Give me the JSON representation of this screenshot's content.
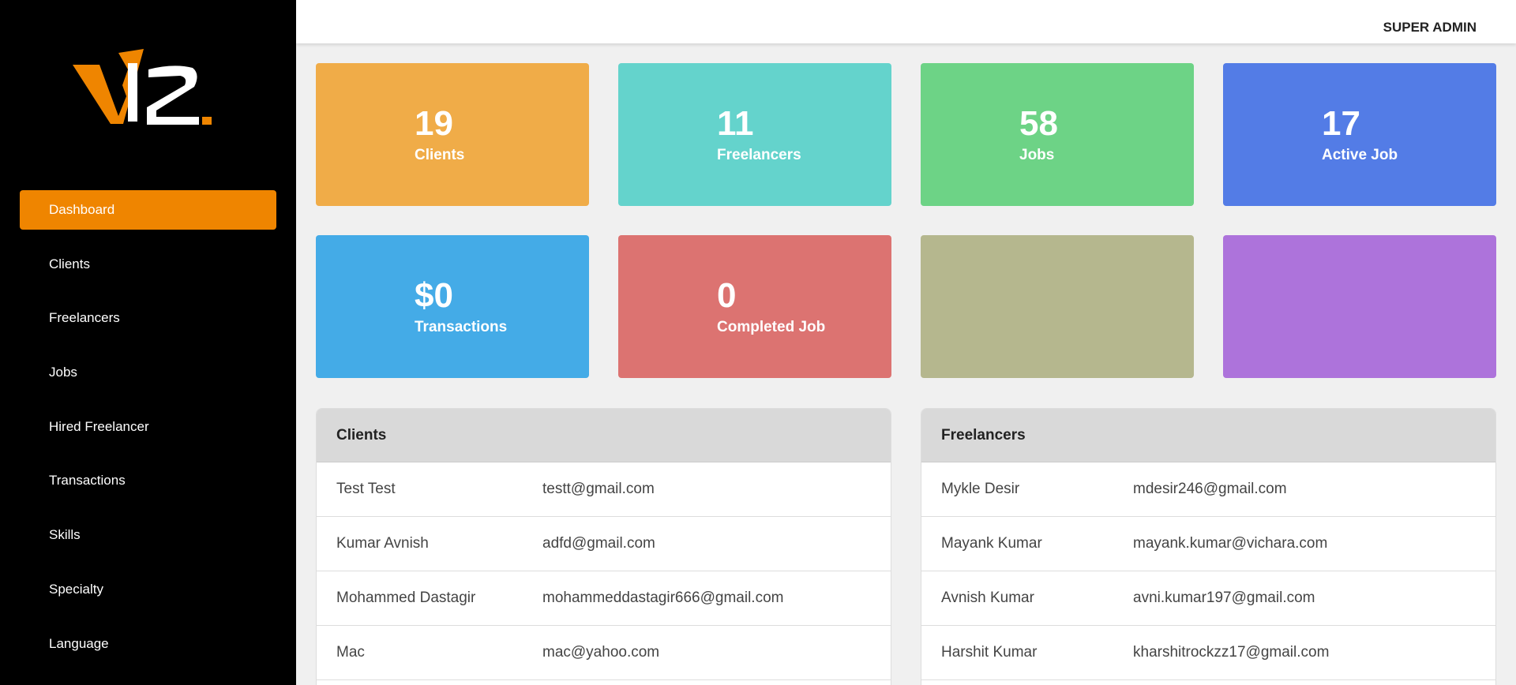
{
  "header": {
    "role": "SUPER ADMIN"
  },
  "logo": {
    "text": "V12"
  },
  "sidebar": {
    "items": [
      {
        "label": "Dashboard",
        "active": true
      },
      {
        "label": "Clients"
      },
      {
        "label": "Freelancers"
      },
      {
        "label": "Jobs"
      },
      {
        "label": "Hired Freelancer"
      },
      {
        "label": "Transactions"
      },
      {
        "label": "Skills"
      },
      {
        "label": "Specialty"
      },
      {
        "label": "Language"
      }
    ]
  },
  "cards": [
    {
      "value": "19",
      "label": "Clients",
      "color": "#f0ac48"
    },
    {
      "value": "11",
      "label": "Freelancers",
      "color": "#64d3cc"
    },
    {
      "value": "58",
      "label": "Jobs",
      "color": "#6dd386"
    },
    {
      "value": "17",
      "label": "Active Job",
      "color": "#537ce6"
    },
    {
      "value": "$0",
      "label": "Transactions",
      "color": "#44abe7"
    },
    {
      "value": "0",
      "label": "Completed Job",
      "color": "#dc7371"
    },
    {
      "value": "",
      "label": "",
      "color": "#b5b78e"
    },
    {
      "value": "",
      "label": "",
      "color": "#ad73db"
    }
  ],
  "clients": {
    "title": "Clients",
    "rows": [
      {
        "name": "Test Test",
        "email": "testt@gmail.com"
      },
      {
        "name": "Kumar Avnish",
        "email": "adfd@gmail.com"
      },
      {
        "name": "Mohammed Dastagir",
        "email": "mohammeddastagir666@gmail.com"
      },
      {
        "name": "Mac",
        "email": "mac@yahoo.com"
      }
    ]
  },
  "freelancers": {
    "title": "Freelancers",
    "rows": [
      {
        "name": "Mykle Desir",
        "email": "mdesir246@gmail.com"
      },
      {
        "name": "Mayank Kumar",
        "email": "mayank.kumar@vichara.com"
      },
      {
        "name": "Avnish Kumar",
        "email": "avni.kumar197@gmail.com"
      },
      {
        "name": "Harshit Kumar",
        "email": "kharshitrockzz17@gmail.com"
      }
    ]
  }
}
